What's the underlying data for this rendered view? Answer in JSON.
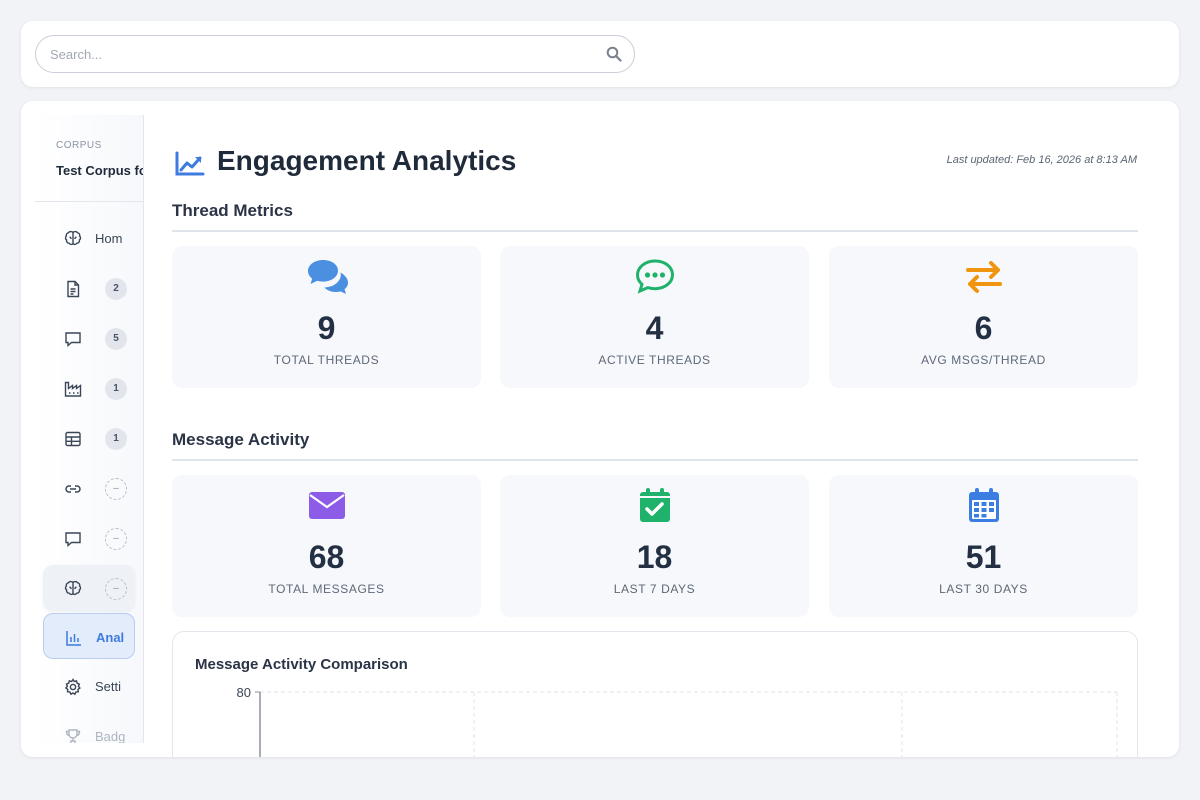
{
  "search": {
    "placeholder": "Search..."
  },
  "sidebar": {
    "corpus_label": "CORPUS",
    "corpus_name": "Test Corpus fo",
    "items": [
      {
        "icon": "brain-icon",
        "label": "Hom"
      },
      {
        "icon": "document-icon",
        "badge": "2"
      },
      {
        "icon": "comment-icon",
        "badge": "5"
      },
      {
        "icon": "factory-icon",
        "badge": "1"
      },
      {
        "icon": "table-icon",
        "badge": "1"
      },
      {
        "icon": "link-icon",
        "badge": "–"
      },
      {
        "icon": "comment-icon",
        "badge": "–"
      },
      {
        "icon": "brain-icon",
        "badge": "–"
      },
      {
        "icon": "bar-chart-icon",
        "label": "Anal"
      },
      {
        "icon": "gear-icon",
        "label": "Setti"
      },
      {
        "icon": "trophy-icon",
        "label": "Badg"
      }
    ]
  },
  "page": {
    "title": "Engagement Analytics",
    "last_updated": "Last updated: Feb 16, 2026 at 8:13 AM"
  },
  "thread_metrics": {
    "title": "Thread Metrics",
    "stats": [
      {
        "icon": "comments-icon",
        "color": "#4a8fe0",
        "value": "9",
        "label": "TOTAL THREADS"
      },
      {
        "icon": "comment-dots-icon",
        "color": "#1fb26a",
        "value": "4",
        "label": "ACTIVE THREADS"
      },
      {
        "icon": "exchange-icon",
        "color": "#f0950f",
        "value": "6",
        "label": "AVG MSGS/THREAD"
      }
    ]
  },
  "message_activity": {
    "title": "Message Activity",
    "stats": [
      {
        "icon": "envelope-icon",
        "color": "#8c5ce8",
        "value": "68",
        "label": "TOTAL MESSAGES"
      },
      {
        "icon": "calendar-check-icon",
        "color": "#1fb26a",
        "value": "18",
        "label": "LAST 7 DAYS"
      },
      {
        "icon": "calendar-icon",
        "color": "#3b7de0",
        "value": "51",
        "label": "LAST 30 DAYS"
      }
    ]
  },
  "chart": {
    "title": "Message Activity Comparison"
  },
  "chart_data": {
    "type": "bar",
    "title": "Message Activity Comparison",
    "y_ticks_visible": [
      "80"
    ],
    "ylim": [
      0,
      80
    ],
    "grid": true
  }
}
